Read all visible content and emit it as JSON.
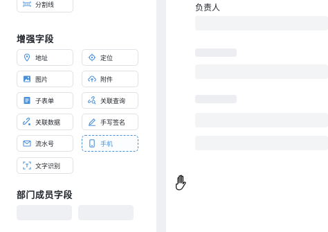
{
  "left": {
    "top_partial_button": {
      "label": "分割线",
      "icon": "divider-icon"
    },
    "enhanced_section_title": "增强字段",
    "enhanced_fields": [
      {
        "label": "地址",
        "icon": "location-pin-icon"
      },
      {
        "label": "定位",
        "icon": "crosshair-icon"
      },
      {
        "label": "图片",
        "icon": "image-icon"
      },
      {
        "label": "附件",
        "icon": "cloud-upload-icon"
      },
      {
        "label": "子表单",
        "icon": "subform-icon"
      },
      {
        "label": "关联查询",
        "icon": "link-search-icon"
      },
      {
        "label": "关联数据",
        "icon": "link-icon"
      },
      {
        "label": "手写签名",
        "icon": "pen-icon"
      },
      {
        "label": "流水号",
        "icon": "envelope-icon"
      },
      {
        "label": "手机",
        "icon": "phone-icon",
        "state": "dragging"
      },
      {
        "label": "文字识别",
        "icon": "scan-text-icon"
      }
    ],
    "member_section_title": "部门成员字段"
  },
  "right": {
    "owner_label": "负责人"
  },
  "colors": {
    "accent": "#4a90d9",
    "border": "#dfe3e8",
    "placeholder": "#eef0f3"
  }
}
